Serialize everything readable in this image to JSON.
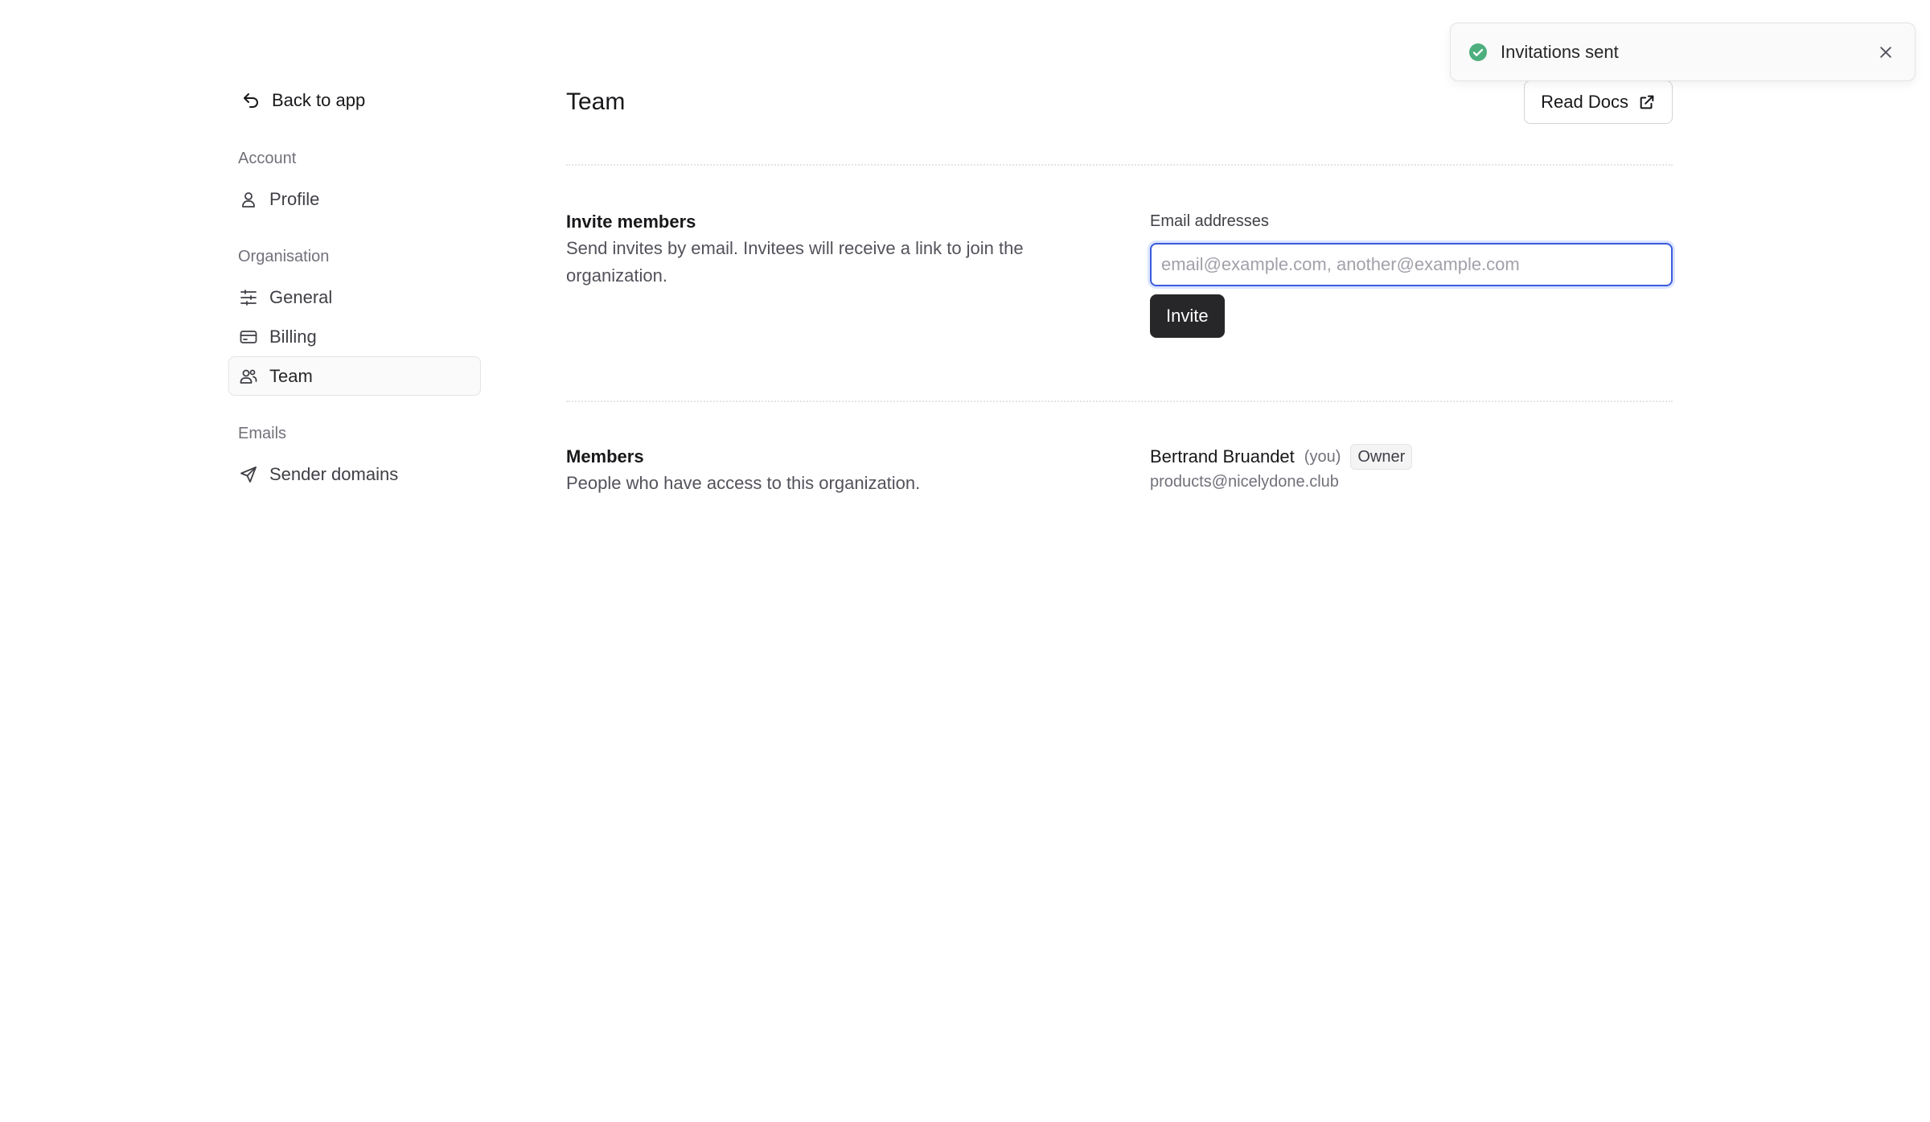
{
  "sidebar": {
    "back_label": "Back to app",
    "back_icon": "arrow-back-icon",
    "sections": [
      {
        "heading": "Account",
        "items": [
          {
            "label": "Profile",
            "icon": "user-icon"
          }
        ]
      },
      {
        "heading": "Organisation",
        "items": [
          {
            "label": "General",
            "icon": "sliders-icon"
          },
          {
            "label": "Billing",
            "icon": "credit-card-icon"
          },
          {
            "label": "Team",
            "icon": "users-icon",
            "active": true
          }
        ]
      },
      {
        "heading": "Emails",
        "items": [
          {
            "label": "Sender domains",
            "icon": "send-icon"
          }
        ]
      }
    ]
  },
  "header": {
    "title": "Team",
    "read_docs_label": "Read Docs",
    "read_docs_icon": "external-link-icon"
  },
  "invite": {
    "title": "Invite members",
    "description": "Send invites by email. Invitees will receive a link to join the organization.",
    "field_label": "Email addresses",
    "input_value": "",
    "input_placeholder": "email@example.com, another@example.com",
    "button_label": "Invite"
  },
  "members": {
    "title": "Members",
    "description": "People who have access to this organization.",
    "list": [
      {
        "name": "Bertrand Bruandet",
        "you_label": "(you)",
        "role": "Owner",
        "email": "products@nicelydone.club"
      }
    ]
  },
  "toast": {
    "message": "Invitations sent",
    "icon": "check-circle-icon",
    "close_icon": "close-icon"
  },
  "colors": {
    "accent_focus": "#3b5bdb",
    "success": "#4ade80",
    "primary_button": "#27272a"
  }
}
